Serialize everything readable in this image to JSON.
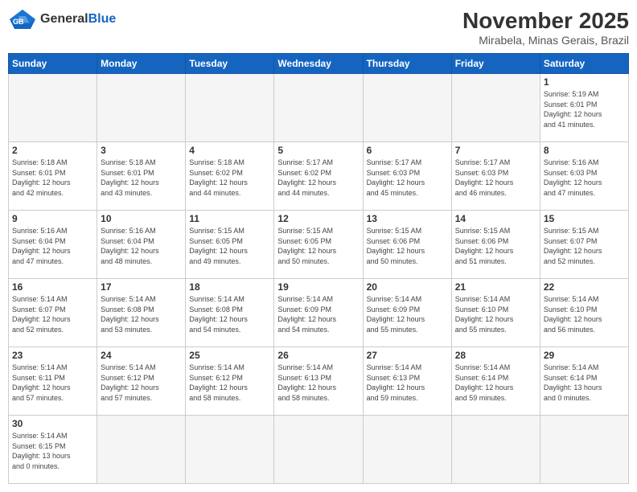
{
  "header": {
    "logo_general": "General",
    "logo_blue": "Blue",
    "month_title": "November 2025",
    "location": "Mirabela, Minas Gerais, Brazil"
  },
  "days_of_week": [
    "Sunday",
    "Monday",
    "Tuesday",
    "Wednesday",
    "Thursday",
    "Friday",
    "Saturday"
  ],
  "weeks": [
    [
      {
        "day": "",
        "info": ""
      },
      {
        "day": "",
        "info": ""
      },
      {
        "day": "",
        "info": ""
      },
      {
        "day": "",
        "info": ""
      },
      {
        "day": "",
        "info": ""
      },
      {
        "day": "",
        "info": ""
      },
      {
        "day": "1",
        "info": "Sunrise: 5:19 AM\nSunset: 6:01 PM\nDaylight: 12 hours\nand 41 minutes."
      }
    ],
    [
      {
        "day": "2",
        "info": "Sunrise: 5:18 AM\nSunset: 6:01 PM\nDaylight: 12 hours\nand 42 minutes."
      },
      {
        "day": "3",
        "info": "Sunrise: 5:18 AM\nSunset: 6:01 PM\nDaylight: 12 hours\nand 43 minutes."
      },
      {
        "day": "4",
        "info": "Sunrise: 5:18 AM\nSunset: 6:02 PM\nDaylight: 12 hours\nand 44 minutes."
      },
      {
        "day": "5",
        "info": "Sunrise: 5:17 AM\nSunset: 6:02 PM\nDaylight: 12 hours\nand 44 minutes."
      },
      {
        "day": "6",
        "info": "Sunrise: 5:17 AM\nSunset: 6:03 PM\nDaylight: 12 hours\nand 45 minutes."
      },
      {
        "day": "7",
        "info": "Sunrise: 5:17 AM\nSunset: 6:03 PM\nDaylight: 12 hours\nand 46 minutes."
      },
      {
        "day": "8",
        "info": "Sunrise: 5:16 AM\nSunset: 6:03 PM\nDaylight: 12 hours\nand 47 minutes."
      }
    ],
    [
      {
        "day": "9",
        "info": "Sunrise: 5:16 AM\nSunset: 6:04 PM\nDaylight: 12 hours\nand 47 minutes."
      },
      {
        "day": "10",
        "info": "Sunrise: 5:16 AM\nSunset: 6:04 PM\nDaylight: 12 hours\nand 48 minutes."
      },
      {
        "day": "11",
        "info": "Sunrise: 5:15 AM\nSunset: 6:05 PM\nDaylight: 12 hours\nand 49 minutes."
      },
      {
        "day": "12",
        "info": "Sunrise: 5:15 AM\nSunset: 6:05 PM\nDaylight: 12 hours\nand 50 minutes."
      },
      {
        "day": "13",
        "info": "Sunrise: 5:15 AM\nSunset: 6:06 PM\nDaylight: 12 hours\nand 50 minutes."
      },
      {
        "day": "14",
        "info": "Sunrise: 5:15 AM\nSunset: 6:06 PM\nDaylight: 12 hours\nand 51 minutes."
      },
      {
        "day": "15",
        "info": "Sunrise: 5:15 AM\nSunset: 6:07 PM\nDaylight: 12 hours\nand 52 minutes."
      }
    ],
    [
      {
        "day": "16",
        "info": "Sunrise: 5:14 AM\nSunset: 6:07 PM\nDaylight: 12 hours\nand 52 minutes."
      },
      {
        "day": "17",
        "info": "Sunrise: 5:14 AM\nSunset: 6:08 PM\nDaylight: 12 hours\nand 53 minutes."
      },
      {
        "day": "18",
        "info": "Sunrise: 5:14 AM\nSunset: 6:08 PM\nDaylight: 12 hours\nand 54 minutes."
      },
      {
        "day": "19",
        "info": "Sunrise: 5:14 AM\nSunset: 6:09 PM\nDaylight: 12 hours\nand 54 minutes."
      },
      {
        "day": "20",
        "info": "Sunrise: 5:14 AM\nSunset: 6:09 PM\nDaylight: 12 hours\nand 55 minutes."
      },
      {
        "day": "21",
        "info": "Sunrise: 5:14 AM\nSunset: 6:10 PM\nDaylight: 12 hours\nand 55 minutes."
      },
      {
        "day": "22",
        "info": "Sunrise: 5:14 AM\nSunset: 6:10 PM\nDaylight: 12 hours\nand 56 minutes."
      }
    ],
    [
      {
        "day": "23",
        "info": "Sunrise: 5:14 AM\nSunset: 6:11 PM\nDaylight: 12 hours\nand 57 minutes."
      },
      {
        "day": "24",
        "info": "Sunrise: 5:14 AM\nSunset: 6:12 PM\nDaylight: 12 hours\nand 57 minutes."
      },
      {
        "day": "25",
        "info": "Sunrise: 5:14 AM\nSunset: 6:12 PM\nDaylight: 12 hours\nand 58 minutes."
      },
      {
        "day": "26",
        "info": "Sunrise: 5:14 AM\nSunset: 6:13 PM\nDaylight: 12 hours\nand 58 minutes."
      },
      {
        "day": "27",
        "info": "Sunrise: 5:14 AM\nSunset: 6:13 PM\nDaylight: 12 hours\nand 59 minutes."
      },
      {
        "day": "28",
        "info": "Sunrise: 5:14 AM\nSunset: 6:14 PM\nDaylight: 12 hours\nand 59 minutes."
      },
      {
        "day": "29",
        "info": "Sunrise: 5:14 AM\nSunset: 6:14 PM\nDaylight: 13 hours\nand 0 minutes."
      }
    ],
    [
      {
        "day": "30",
        "info": "Sunrise: 5:14 AM\nSunset: 6:15 PM\nDaylight: 13 hours\nand 0 minutes."
      },
      {
        "day": "",
        "info": ""
      },
      {
        "day": "",
        "info": ""
      },
      {
        "day": "",
        "info": ""
      },
      {
        "day": "",
        "info": ""
      },
      {
        "day": "",
        "info": ""
      },
      {
        "day": "",
        "info": ""
      }
    ]
  ]
}
